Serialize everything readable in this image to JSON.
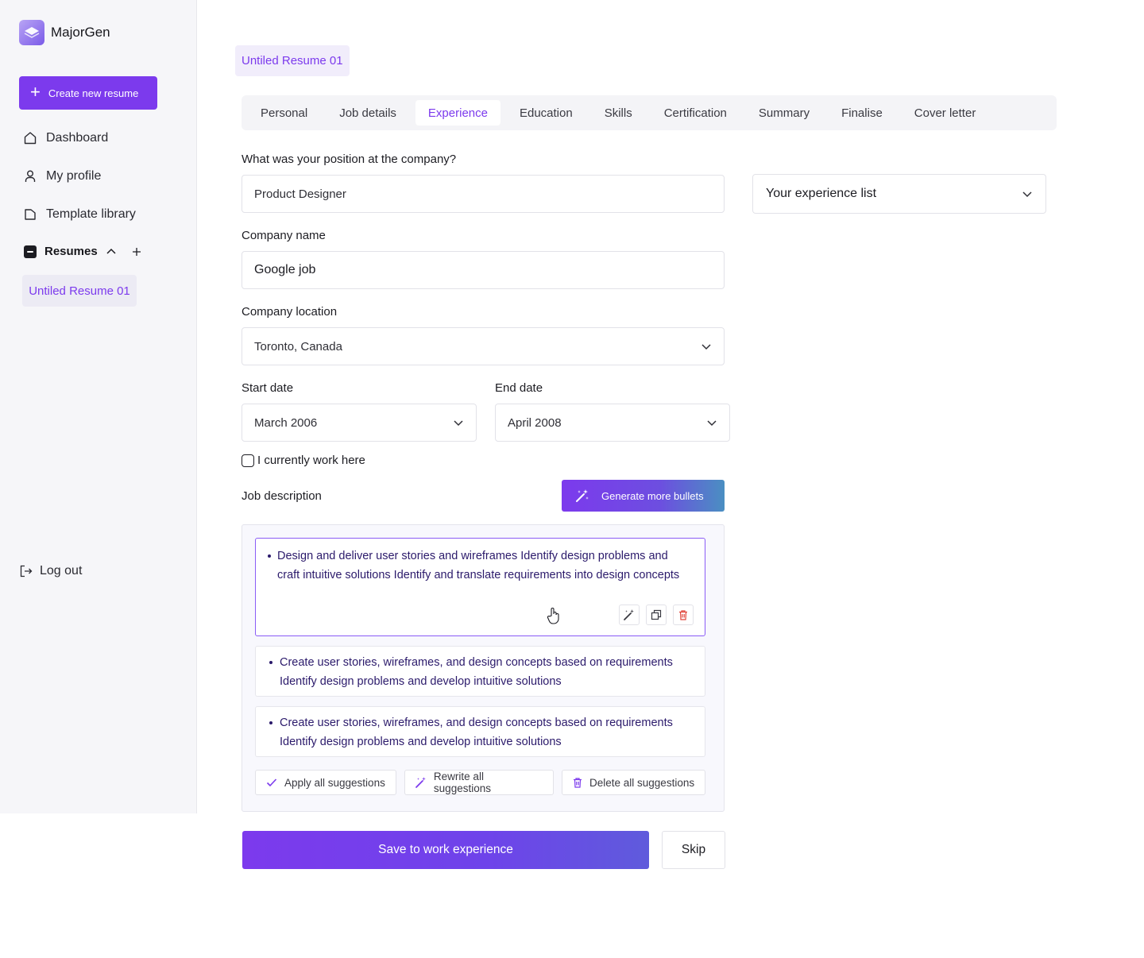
{
  "app": {
    "name": "MajorGen"
  },
  "sidebar": {
    "create_label": "Create new resume",
    "items": [
      {
        "label": "Dashboard",
        "icon": "home-icon"
      },
      {
        "label": "My profile",
        "icon": "user-icon"
      },
      {
        "label": "Template library",
        "icon": "folder-icon"
      }
    ],
    "resumes_label": "Resumes",
    "resume_items": [
      "Untiled Resume 01"
    ],
    "logout_label": "Log out"
  },
  "header": {
    "resume_title": "Untiled Resume 01"
  },
  "tabs": [
    "Personal",
    "Job details",
    "Experience",
    "Education",
    "Skills",
    "Certification",
    "Summary",
    "Finalise",
    "Cover letter"
  ],
  "active_tab": "Experience",
  "form": {
    "position_label": "What was your position at the company?",
    "position_value": "Product Designer",
    "company_label": "Company name",
    "company_value": "Google job",
    "location_label": "Company location",
    "location_value": "Toronto, Canada",
    "start_label": "Start date",
    "start_value": "March 2006",
    "end_label": "End date",
    "end_value": "April 2008",
    "current_label": "I currently work here",
    "current_checked": false,
    "desc_label": "Job description",
    "generate_label": "Generate more bullets"
  },
  "bullets": [
    {
      "line1": "Design and deliver user stories and wireframes Identify design problems and",
      "line2": "craft intuitive solutions Identify and translate requirements into design concepts"
    },
    {
      "line1": "Create user stories, wireframes, and design concepts based on requirements",
      "line2": "Identify design problems and develop intuitive solutions"
    },
    {
      "line1": "Create user stories, wireframes, and design concepts based on requirements",
      "line2": "Identify design problems and develop intuitive solutions"
    }
  ],
  "suggestions": {
    "apply": "Apply all suggestions",
    "rewrite": "Rewrite all suggestions",
    "delete": "Delete all suggestions"
  },
  "actions": {
    "save": "Save to work experience",
    "skip": "Skip"
  },
  "experience_list": {
    "label": "Your experience list"
  },
  "colors": {
    "accent": "#7c3aed",
    "danger": "#e0453a",
    "bullet_text": "#2b1a6b"
  }
}
